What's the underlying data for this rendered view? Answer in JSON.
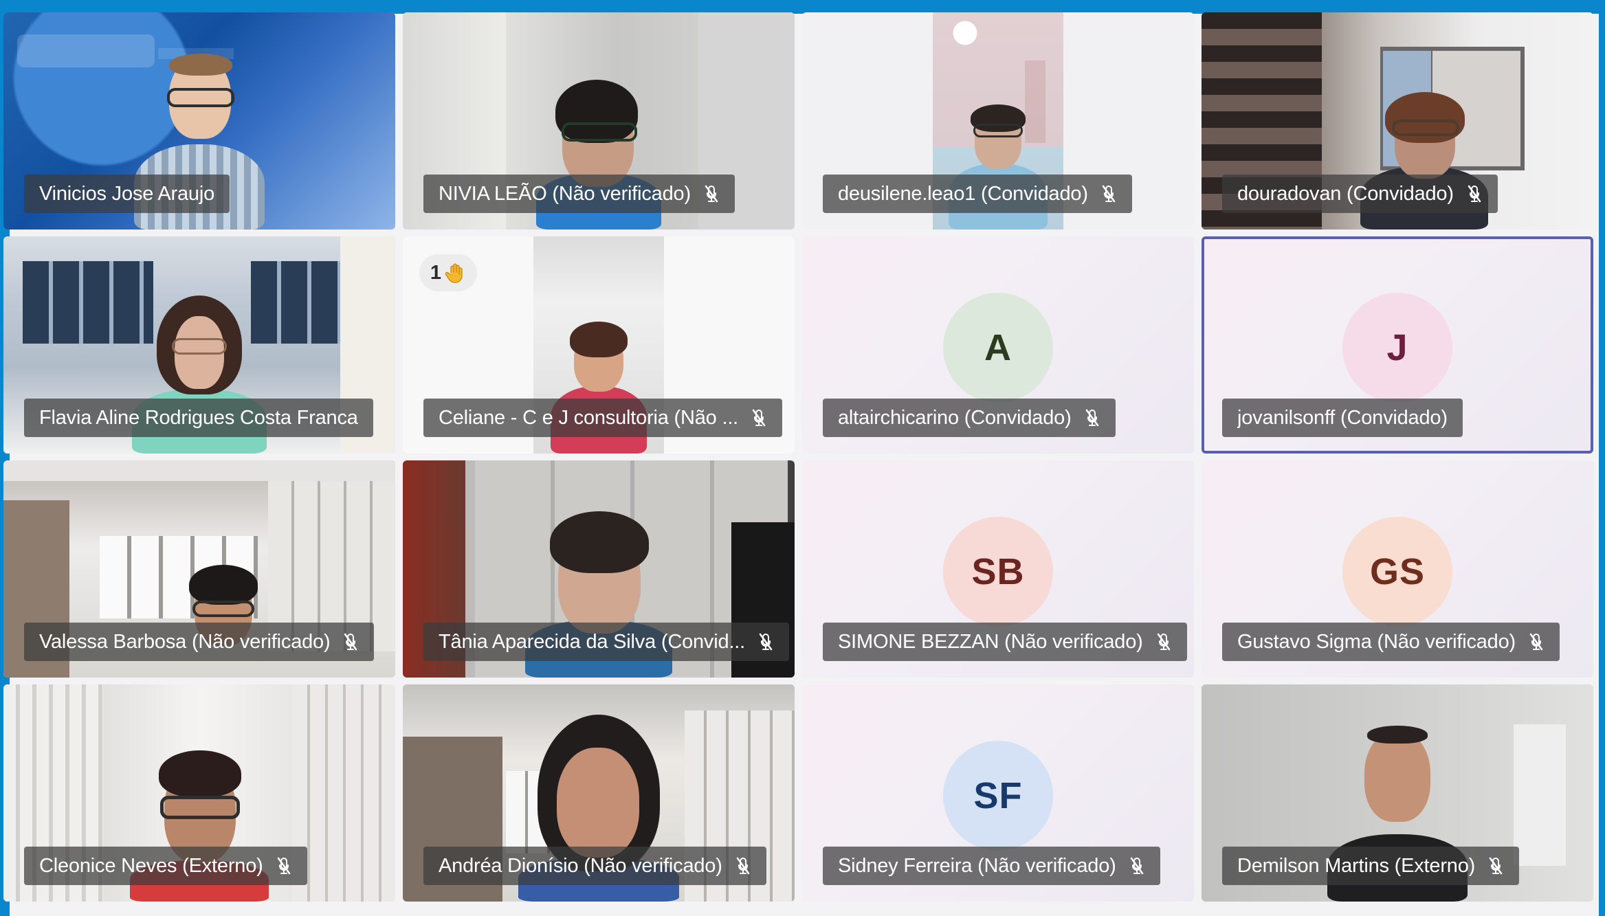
{
  "participants": [
    {
      "name": "Vinicios Jose Araujo",
      "muted": false
    },
    {
      "name": "NIVIA LEÃO (Não verificado)",
      "muted": true
    },
    {
      "name": "deusilene.leao1 (Convidado)",
      "muted": true
    },
    {
      "name": "douradovan (Convidado)",
      "muted": true
    },
    {
      "name": "Flavia Aline Rodrigues Costa Franca",
      "muted": false
    },
    {
      "name": "Celiane - C e J consultoria (Não ...",
      "muted": true,
      "raised_hand_count": "1",
      "raised_hand_icon": "raised-hand-icon"
    },
    {
      "name": "altairchicarino (Convidado)",
      "muted": true,
      "avatar_initials": "A"
    },
    {
      "name": "jovanilsonff (Convidado)",
      "muted": false,
      "avatar_initials": "J"
    },
    {
      "name": "Valessa Barbosa (Não verificado)",
      "muted": true
    },
    {
      "name": "Tânia Aparecida da Silva (Convid...",
      "muted": true
    },
    {
      "name": "SIMONE BEZZAN (Não verificado)",
      "muted": true,
      "avatar_initials": "SB"
    },
    {
      "name": "Gustavo Sigma (Não verificado)",
      "muted": true,
      "avatar_initials": "GS"
    },
    {
      "name": "Cleonice Neves (Externo)",
      "muted": true
    },
    {
      "name": "Andréa Dionísio (Não verificado)",
      "muted": true
    },
    {
      "name": "Sidney Ferreira (Não verificado)",
      "muted": true,
      "avatar_initials": "SF"
    },
    {
      "name": "Demilson Martins (Externo)",
      "muted": true
    }
  ],
  "colors": {
    "window_frame": "#0a86cc",
    "raised_hand_border": "#e7b53a",
    "active_speaker_border": "#5a5fb0",
    "name_tag_background": "rgba(60,60,60,0.72)"
  },
  "icons": {
    "mic_off": "mic-off-icon",
    "raised_hand": "raised-hand-icon"
  }
}
